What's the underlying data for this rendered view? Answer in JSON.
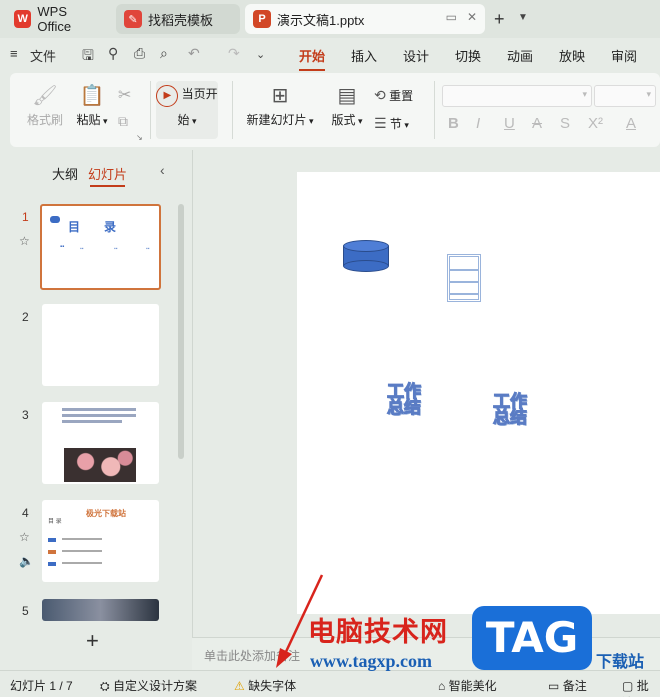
{
  "tabs": {
    "wps": "WPS Office",
    "templates": "找稻壳模板",
    "document": "演示文稿1.pptx"
  },
  "menu": {
    "file": "文件",
    "tabs": [
      "开始",
      "插入",
      "设计",
      "切换",
      "动画",
      "放映",
      "审阅"
    ],
    "active_tab": "开始"
  },
  "ribbon": {
    "format_painter": "格式刷",
    "paste": "粘贴",
    "play_from_current": "当页开始",
    "new_slide": "新建幻灯片",
    "layout": "版式",
    "reset": "重置",
    "section": "节"
  },
  "left_panel": {
    "outline_tab": "大纲",
    "slides_tab": "幻灯片",
    "thumb1_title": "目　　录",
    "thumb4_title": "极光下载站",
    "thumb4_sub": "目  录"
  },
  "slide": {
    "text1": "工作总结",
    "text2": "工作总结"
  },
  "notes_placeholder": "单击此处添加备注",
  "status": {
    "slide_count": "幻灯片 1 / 7",
    "custom_design": "自定义设计方案",
    "missing_font": "缺失字体",
    "smart_beautify": "智能美化",
    "notes": "备注",
    "comments": "批注"
  },
  "watermark": {
    "site_cn": "电脑技术网",
    "url": "www.tagxp.com",
    "tag": "TAG",
    "download": "下载站"
  },
  "colors": {
    "accent": "#c33c1a",
    "watermark_red": "#d8241c",
    "watermark_blue": "#1a6fd8"
  }
}
